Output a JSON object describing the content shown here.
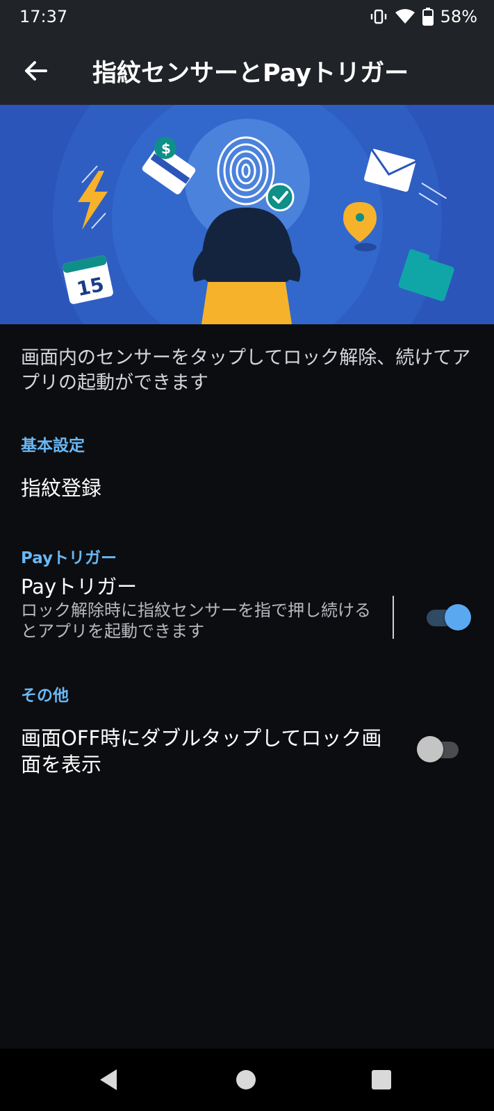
{
  "status_bar": {
    "time": "17:37",
    "battery_percent": "58%",
    "icons": [
      "vibrate-icon",
      "wifi-icon",
      "battery-icon"
    ]
  },
  "app_bar": {
    "title": "指紋センサーとPayトリガー",
    "back_icon": "arrow-back-icon"
  },
  "hero": {
    "calendar_day": "15"
  },
  "description": "画面内のセンサーをタップしてロック解除、続けてアプリの起動ができます",
  "sections": {
    "basic": {
      "header": "基本設定",
      "fingerprint_registration": "指紋登録"
    },
    "pay_trigger": {
      "header": "Payトリガー",
      "title": "Payトリガー",
      "summary": "ロック解除時に指紋センサーを指で押し続けるとアプリを起動できます",
      "enabled": true
    },
    "other": {
      "header": "その他",
      "double_tap_title": "画面OFF時にダブルタップしてロック画面を表示",
      "enabled": false
    }
  },
  "colors": {
    "accent": "#69b8f5",
    "toggle_on_thumb": "#5aa8f0",
    "toggle_on_track": "#2f4a62",
    "toggle_off_thumb": "#c4c4c4",
    "toggle_off_track": "#4a4c50",
    "background": "#0c0d10",
    "appbar": "#202327"
  },
  "nav_bar": {
    "icons": [
      "back-triangle-icon",
      "home-circle-icon",
      "recents-square-icon"
    ]
  }
}
